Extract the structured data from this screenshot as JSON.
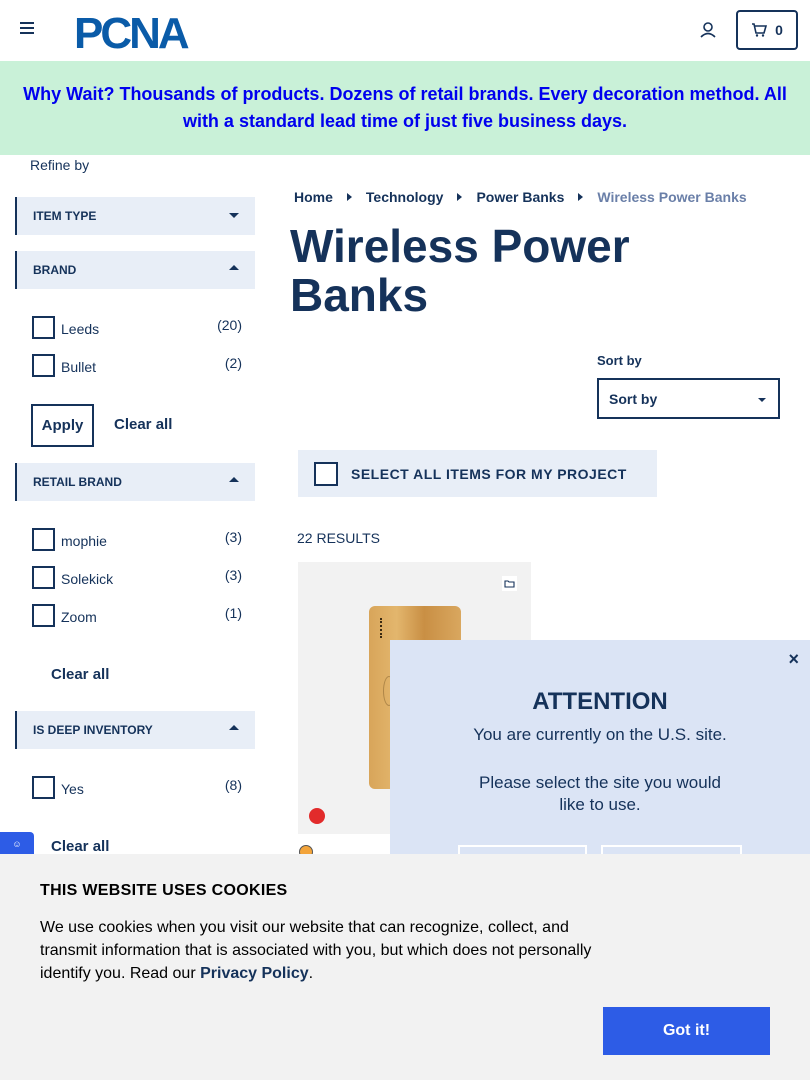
{
  "header": {
    "logo_text": "PCNA",
    "cart_count": "0"
  },
  "banner": {
    "text": "Why Wait? Thousands of products. Dozens of retail brands. Every decoration method. All with a standard lead time of just five business days."
  },
  "sidebar": {
    "refine_label": "Refine by",
    "facets": {
      "item_type": "ITEM TYPE",
      "brand": "BRAND",
      "retail_brand": "RETAIL BRAND",
      "deep_inventory": "IS DEEP INVENTORY"
    },
    "brand_options": [
      {
        "label": "Leeds",
        "count": "(20)"
      },
      {
        "label": "Bullet",
        "count": "(2)"
      }
    ],
    "retail_brand_options": [
      {
        "label": "mophie",
        "count": "(3)"
      },
      {
        "label": "Solekick",
        "count": "(3)"
      },
      {
        "label": "Zoom",
        "count": "(1)"
      }
    ],
    "deep_inventory_options": [
      {
        "label": "Yes",
        "count": "(8)"
      }
    ],
    "apply_label": "Apply",
    "clear_all_label": "Clear all"
  },
  "breadcrumb": {
    "items": [
      "Home",
      "Technology",
      "Power Banks"
    ],
    "current": "Wireless Power Banks"
  },
  "main": {
    "title": "Wireless Power Banks",
    "sort_label": "Sort by",
    "sort_value": "Sort by",
    "select_all_label": "SELECT ALL ITEMS FOR MY PROJECT",
    "results_count": "22 RESULTS"
  },
  "modal": {
    "close": "×",
    "title": "ATTENTION",
    "line1": "You are currently on the U.S. site.",
    "line2": "Please select the site you would like to use."
  },
  "cookie": {
    "title": "THIS WEBSITE USES COOKIES",
    "text_before": "We use cookies when you visit our website that can recognize, collect, and transmit information that is associated with you, but which does not personally identify you. Read our ",
    "link": "Privacy Policy",
    "text_after": ".",
    "button": "Got it!"
  },
  "colors": {
    "navy": "#15325a",
    "banner_bg": "#c9f1d8",
    "banner_text": "#0000ee",
    "accent_blue": "#2d5ce6",
    "facet_bg": "#e8eef7",
    "modal_bg": "#dbe4f5"
  },
  "icons": [
    "menu-icon",
    "account-icon",
    "cart-icon",
    "caret-down-icon",
    "caret-up-icon",
    "folder-icon",
    "close-icon"
  ]
}
